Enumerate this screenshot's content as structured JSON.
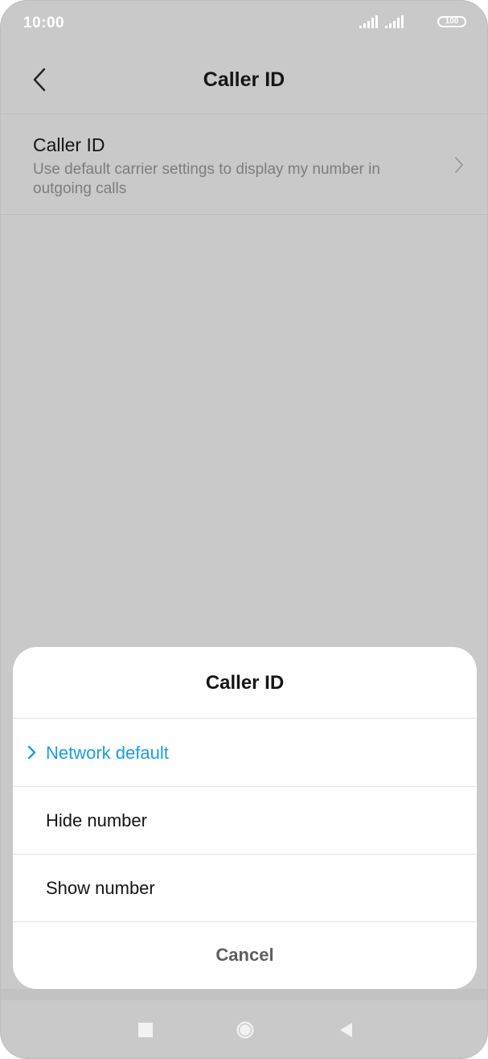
{
  "status_bar": {
    "time": "10:00",
    "battery": "100",
    "icons": [
      "signal-icon",
      "signal-icon",
      "battery-icon"
    ]
  },
  "header": {
    "title": "Caller ID",
    "back_icon": "back-arrow-icon"
  },
  "settings": {
    "caller_id": {
      "title": "Caller ID",
      "description": "Use default carrier settings to display my number in outgoing calls",
      "chevron_icon": "chevron-right-icon"
    }
  },
  "dialog": {
    "title": "Caller ID",
    "options": [
      {
        "label": "Network default",
        "selected": true
      },
      {
        "label": "Hide number",
        "selected": false
      },
      {
        "label": "Show number",
        "selected": false
      }
    ],
    "cancel_label": "Cancel"
  },
  "colors": {
    "accent": "#1a9fe0",
    "scrim_background": "#c9c9c9",
    "dialog_background": "#ffffff"
  },
  "nav_bar": {
    "icons": [
      "recent-apps-icon",
      "home-icon",
      "back-triangle-icon"
    ]
  }
}
